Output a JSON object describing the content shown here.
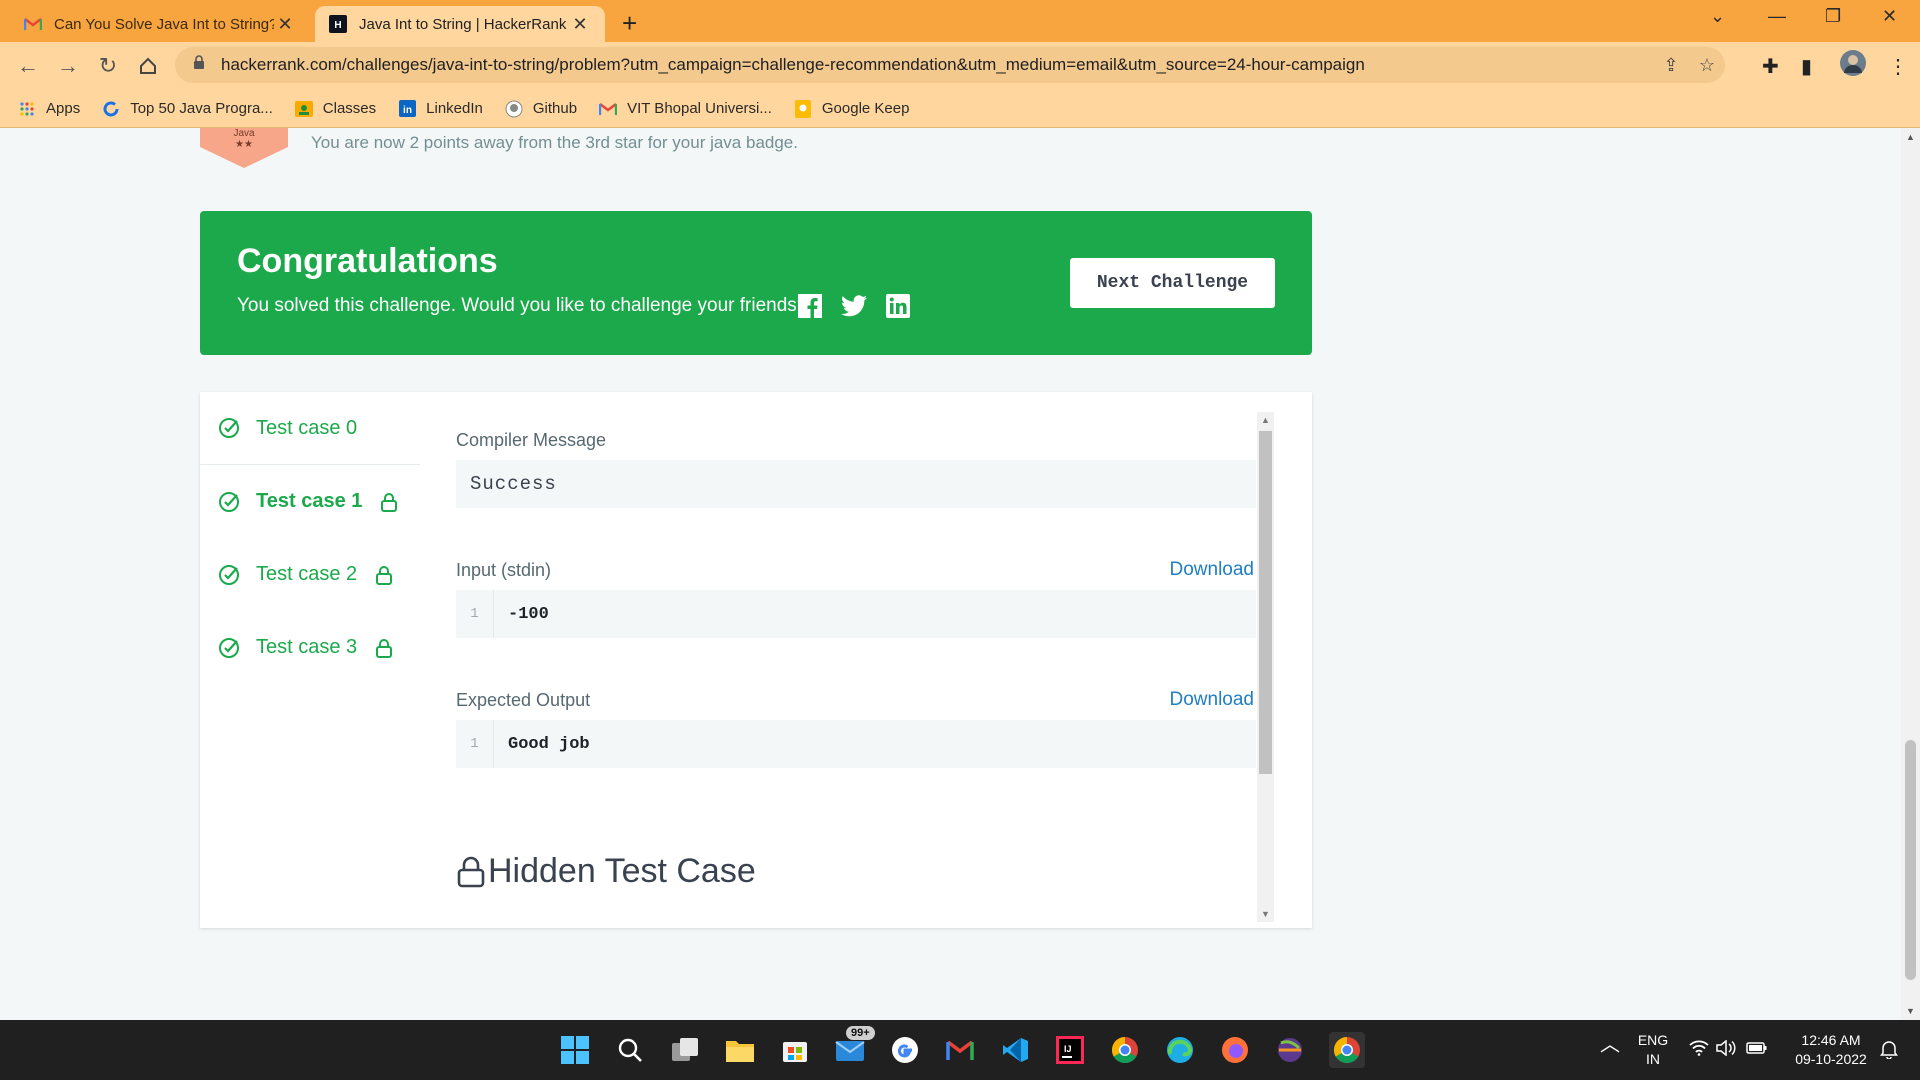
{
  "browser": {
    "tabs": [
      {
        "title": "Can You Solve Java Int to String?",
        "favicon": "gmail-icon",
        "active": false
      },
      {
        "title": "Java Int to String | HackerRank",
        "favicon": "hackerrank-icon",
        "active": true
      }
    ],
    "url": "hackerrank.com/challenges/java-int-to-string/problem?utm_campaign=challenge-recommendation&utm_medium=email&utm_source=24-hour-campaign",
    "bookmarks": [
      {
        "label": "Apps",
        "icon": "apps-grid-icon"
      },
      {
        "label": "Top 50 Java Progra...",
        "icon": "refresh-blue-icon"
      },
      {
        "label": "Classes",
        "icon": "classroom-icon"
      },
      {
        "label": "LinkedIn",
        "icon": "linkedin-icon"
      },
      {
        "label": "Github",
        "icon": "github-icon"
      },
      {
        "label": "VIT Bhopal Universi...",
        "icon": "gmail-icon"
      },
      {
        "label": "Google Keep",
        "icon": "keep-icon"
      }
    ]
  },
  "badge": {
    "label": "Java",
    "stars": "★★",
    "message": "You are now 2 points away from the 3rd star for your java badge."
  },
  "congrats": {
    "title": "Congratulations",
    "subtitle": "You solved this challenge. Would you like to challenge your friends?",
    "next_button": "Next Challenge"
  },
  "test_cases": [
    {
      "label": "Test case 0",
      "locked": false,
      "selected": false
    },
    {
      "label": "Test case 1",
      "locked": true,
      "selected": true
    },
    {
      "label": "Test case 2",
      "locked": true,
      "selected": false
    },
    {
      "label": "Test case 3",
      "locked": true,
      "selected": false
    }
  ],
  "detail": {
    "compiler_label": "Compiler Message",
    "compiler_message": "Success",
    "input_label": "Input (stdin)",
    "input_download": "Download",
    "input_line_no": "1",
    "input_value": "-100",
    "output_label": "Expected Output",
    "output_download": "Download",
    "output_line_no": "1",
    "output_value": "Good job",
    "hidden_label": "Hidden Test Case"
  },
  "taskbar": {
    "mail_badge": "99+",
    "lang_top": "ENG",
    "lang_bottom": "IN",
    "time": "12:46 AM",
    "date": "09-10-2022"
  },
  "colors": {
    "accent_green": "#1ba94c",
    "link_blue": "#1f7ec4",
    "chrome_orange": "#f9a53f"
  }
}
